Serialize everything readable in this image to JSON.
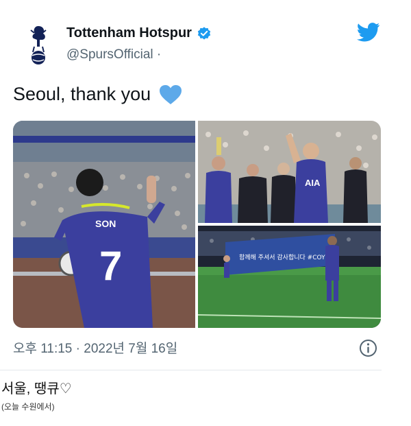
{
  "tweet": {
    "display_name": "Tottenham Hotspur",
    "handle": "@SpursOfficial ·",
    "text": "Seoul, thank you",
    "timestamp": "오후 11:15 · 2022년 7월 16일",
    "icons": {
      "avatar": "spurs-cockerel-logo",
      "verified": "verified-badge-icon",
      "brand": "twitter-bird-icon",
      "emoji": "blue-heart-icon",
      "info": "info-icon"
    },
    "media": [
      {
        "name": "photo-son-number-7",
        "jersey_name": "SON",
        "jersey_number": "7"
      },
      {
        "name": "photo-players-applauding",
        "sponsor": "AIA"
      },
      {
        "name": "photo-banner-on-pitch",
        "banner_text": "함께해 주셔서 감사합니다 #COYS"
      }
    ],
    "colors": {
      "accent": "#1d9bf0",
      "text": "#0f1419",
      "secondary": "#536471",
      "kit_purple": "#3b3f9e",
      "kit_yellow": "#d6e82b"
    }
  },
  "caption": {
    "title": "서울, 땡큐♡",
    "note": "(오늘 수원에서)"
  }
}
